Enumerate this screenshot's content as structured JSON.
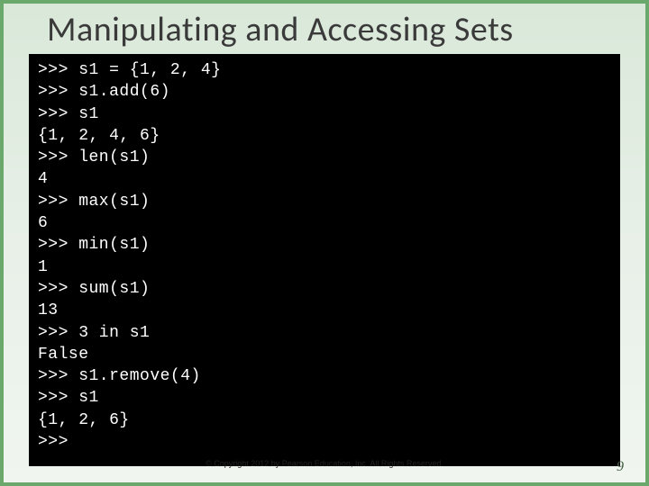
{
  "title": "Manipulating and Accessing Sets",
  "code": ">>> s1 = {1, 2, 4}\n>>> s1.add(6)\n>>> s1\n{1, 2, 4, 6}\n>>> len(s1)\n4\n>>> max(s1)\n6\n>>> min(s1)\n1\n>>> sum(s1)\n13\n>>> 3 in s1\nFalse\n>>> s1.remove(4)\n>>> s1\n{1, 2, 6}\n>>> ",
  "copyright": "© Copyright 2012 by Pearson Education, Inc. All Rights Reserved.",
  "page_number": "9"
}
